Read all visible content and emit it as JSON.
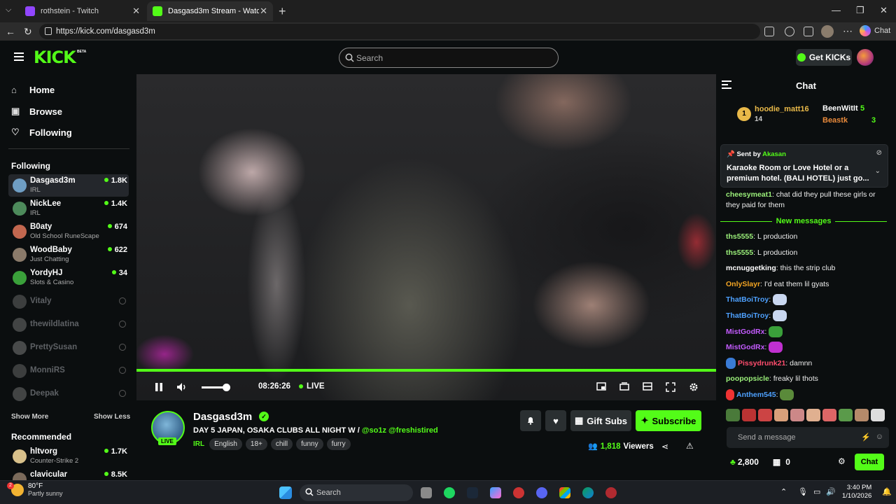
{
  "browser": {
    "tabs": [
      {
        "title": "rothstein - Twitch",
        "favicon": "twitch-icon",
        "color": "#9146ff"
      },
      {
        "title": "Dasgasd3m Stream - Watch Live o",
        "favicon": "kick-icon",
        "color": "#53fc18"
      }
    ],
    "url": "https://kick.com/dasgasd3m",
    "chat_label": "Chat"
  },
  "header": {
    "logo": "KICK",
    "beta": "BETA",
    "search_placeholder": "Search",
    "get_kicks": "Get KICKs",
    "accent": "#53fc18"
  },
  "sidebar": {
    "nav": [
      {
        "label": "Home",
        "icon": "home-icon"
      },
      {
        "label": "Browse",
        "icon": "browse-icon"
      },
      {
        "label": "Following",
        "icon": "heart-icon"
      }
    ],
    "following_header": "Following",
    "channels": [
      {
        "name": "Dasgasd3m",
        "category": "IRL",
        "viewers": "1.8K",
        "live": true
      },
      {
        "name": "NickLee",
        "category": "IRL",
        "viewers": "1.4K",
        "live": true
      },
      {
        "name": "B0aty",
        "category": "Old School RuneScape",
        "viewers": "674",
        "live": true
      },
      {
        "name": "WoodBaby",
        "category": "Just Chatting",
        "viewers": "622",
        "live": true
      },
      {
        "name": "YordyHJ",
        "category": "Slots & Casino",
        "viewers": "34",
        "live": true
      },
      {
        "name": "Vitaly",
        "live": false
      },
      {
        "name": "thewildlatina",
        "live": false
      },
      {
        "name": "PrettySusan",
        "live": false
      },
      {
        "name": "MonniRS",
        "live": false
      },
      {
        "name": "Deepak",
        "live": false
      }
    ],
    "show_more": "Show More",
    "show_less": "Show Less",
    "recommended_header": "Recommended",
    "recommended": [
      {
        "name": "hltvorg",
        "category": "Counter-Strike 2",
        "viewers": "1.7K"
      },
      {
        "name": "clavicular",
        "category": "",
        "viewers": "8.5K"
      }
    ]
  },
  "player": {
    "progress": 1.0,
    "volume": 0.75,
    "time": "08:26:26",
    "live_label": "LIVE"
  },
  "stream": {
    "name": "Dasgasd3m",
    "live_tag": "LIVE",
    "title": "DAY 5 JAPAN, OSAKA CLUBS ALL NIGHT W / ",
    "mentions": "@so1z @freshistired",
    "category": "IRL",
    "tags": [
      "English",
      "18+",
      "chill",
      "funny",
      "furry"
    ],
    "gift_subs": "Gift Subs",
    "subscribe": "Subscribe",
    "viewers": "1,818",
    "viewers_label": "Viewers"
  },
  "chat": {
    "title": "Chat",
    "leaderboard": {
      "first": {
        "rank": "1",
        "name": "hoodie_matt16",
        "count": "14"
      },
      "second": {
        "name": "BeenWitIt",
        "count": "5"
      },
      "third": {
        "name": "Beastk",
        "count": "3"
      }
    },
    "pinned": {
      "sent_by": "Sent by",
      "user": "Akasan",
      "text": "Karaoke Room or Love Hotel or a premium hotel. (BALI HOTEL) just go..."
    },
    "pre_messages": [
      {
        "user": "cheesymeat1",
        "color": "#9bf07a",
        "text": "chat did they pull these girls or they paid for them"
      }
    ],
    "new_messages_label": "New messages",
    "messages": [
      {
        "user": "ths5555",
        "color": "#9bf07a",
        "text": "L production"
      },
      {
        "user": "ths5555",
        "color": "#9bf07a",
        "text": "L production"
      },
      {
        "user": "mcnuggetking",
        "color": "#ffffff",
        "text": "this the strip club"
      },
      {
        "user": "OnlySlayr",
        "color": "#f5a623",
        "text": "I'd eat them lil gyats"
      },
      {
        "user": "ThatBoiTroy",
        "color": "#4ea1ff",
        "text": ""
      },
      {
        "user": "ThatBoiTroy",
        "color": "#4ea1ff",
        "text": ""
      },
      {
        "user": "MistGodRx",
        "color": "#c45cff",
        "text": ""
      },
      {
        "user": "MistGodRx",
        "color": "#c45cff",
        "text": ""
      },
      {
        "user": "Pissydrunk21",
        "color": "#ff4d6d",
        "text": "damnn"
      },
      {
        "user": "poopopsicle",
        "color": "#9bf07a",
        "text": "freaky lil thots"
      },
      {
        "user": "Anthem545",
        "color": "#4ea1ff",
        "text": ""
      }
    ],
    "send_placeholder": "Send a message",
    "kicks": "2,800",
    "gifts": "0",
    "send_label": "Chat"
  },
  "taskbar": {
    "temp": "80°F",
    "condition": "Partly sunny",
    "badge": "2",
    "search": "Search",
    "time": "3:40 PM",
    "date": "1/10/2026"
  }
}
